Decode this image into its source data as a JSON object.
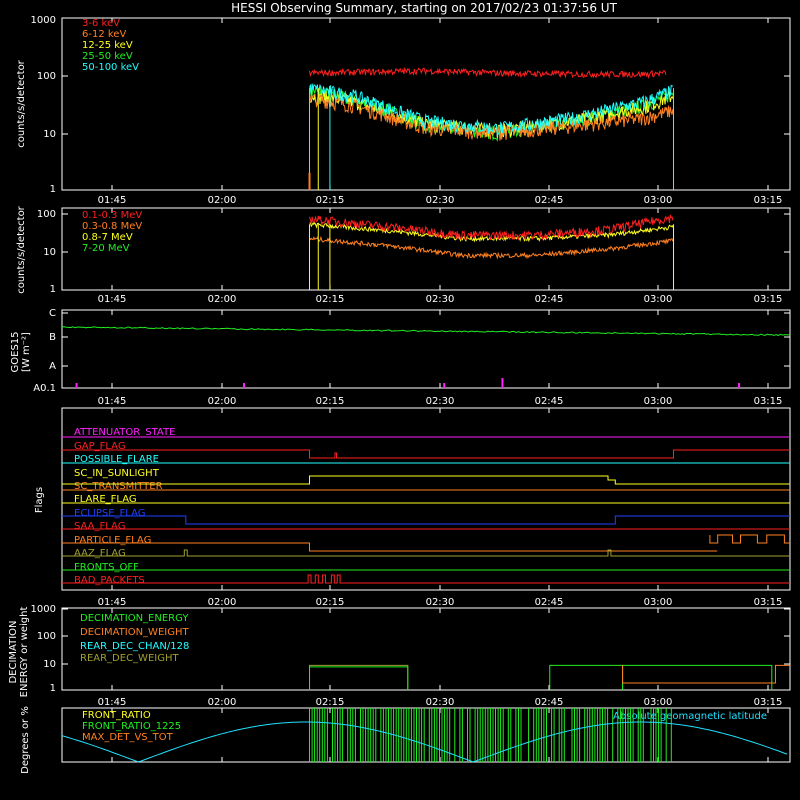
{
  "title": "HESSI Observing Summary, starting on 2017/02/23 01:37:56 UT",
  "colors": {
    "red": "#ff2020",
    "orange": "#ff8020",
    "yellow": "#ffff20",
    "green": "#20ee20",
    "cyan": "#20ffff",
    "magenta": "#ff20ff",
    "blue": "#2040ff",
    "olive": "#a0a030",
    "white": "#ffffff",
    "light_blue": "#20e0ff"
  },
  "time_ticks": [
    "01:45",
    "02:00",
    "02:15",
    "02:30",
    "02:45",
    "03:00",
    "03:15"
  ],
  "chart_data": [
    {
      "type": "line",
      "name": "xray-lightcurve",
      "ylabel": "counts/s/detector",
      "yscale": "log",
      "yticks": [
        "1",
        "10",
        "100",
        "1000"
      ],
      "legend": [
        {
          "label": "3-6 keV",
          "color": "#ff2020"
        },
        {
          "label": "6-12 keV",
          "color": "#ff8020"
        },
        {
          "label": "12-25 keV",
          "color": "#ffff20"
        },
        {
          "label": "25-50 keV",
          "color": "#20ee20"
        },
        {
          "label": "50-100 keV",
          "color": "#20ffff"
        }
      ],
      "legend_placement": "top-left",
      "x_unit": "minutes since 01:37:56",
      "x_range": [
        0,
        100
      ],
      "ylim": [
        1,
        1000
      ],
      "data_interval": [
        34,
        84
      ],
      "series": [
        {
          "name": "3-6 keV",
          "points": [
            [
              34,
              110
            ],
            [
              50,
              120
            ],
            [
              60,
              110
            ],
            [
              70,
              105
            ],
            [
              80,
              105
            ],
            [
              83,
              110
            ]
          ]
        },
        {
          "name": "6-12 keV",
          "points": [
            [
              34,
              40
            ],
            [
              40,
              30
            ],
            [
              50,
              12
            ],
            [
              60,
              10
            ],
            [
              70,
              13
            ],
            [
              80,
              18
            ],
            [
              84,
              25
            ]
          ]
        },
        {
          "name": "12-25 keV",
          "points": [
            [
              34,
              45
            ],
            [
              40,
              35
            ],
            [
              50,
              14
            ],
            [
              60,
              11
            ],
            [
              70,
              16
            ],
            [
              80,
              28
            ],
            [
              84,
              45
            ]
          ]
        },
        {
          "name": "25-50 keV",
          "points": [
            [
              34,
              55
            ],
            [
              40,
              40
            ],
            [
              50,
              14
            ],
            [
              60,
              10
            ],
            [
              70,
              15
            ],
            [
              80,
              30
            ],
            [
              84,
              50
            ]
          ]
        },
        {
          "name": "50-100 keV",
          "points": [
            [
              34,
              60
            ],
            [
              40,
              45
            ],
            [
              50,
              16
            ],
            [
              60,
              12
            ],
            [
              70,
              18
            ],
            [
              80,
              35
            ],
            [
              84,
              55
            ]
          ]
        }
      ]
    },
    {
      "type": "line",
      "name": "gamma-lightcurve",
      "ylabel": "counts/s/detector",
      "yscale": "log",
      "yticks": [
        "1",
        "10",
        "100"
      ],
      "legend": [
        {
          "label": "0.1-0.3 MeV",
          "color": "#ff2020"
        },
        {
          "label": "0.3-0.8 MeV",
          "color": "#ff8020"
        },
        {
          "label": "0.8-7 MeV",
          "color": "#ffff20"
        },
        {
          "label": "7-20 MeV",
          "color": "#20ee20"
        }
      ],
      "ylim": [
        1,
        100
      ]
    },
    {
      "type": "line",
      "name": "goes",
      "ylabel": "GOES15",
      "ylabel2": "[W m⁻²]",
      "yticks": [
        "A0.1",
        "A",
        "B",
        "C"
      ]
    },
    {
      "type": "table",
      "name": "flags",
      "ylabel": "Flags",
      "flags": [
        {
          "label": "ATTENUATOR_STATE",
          "color": "#ff20ff"
        },
        {
          "label": "GAP_FLAG",
          "color": "#ff2020"
        },
        {
          "label": "POSSIBLE_FLARE",
          "color": "#20ffff"
        },
        {
          "label": "SC_IN_SUNLIGHT",
          "color": "#ffff20"
        },
        {
          "label": "SC_TRANSMITTER",
          "color": "#ff8020"
        },
        {
          "label": "FLARE_FLAG",
          "color": "#ffff20"
        },
        {
          "label": "ECLIPSE_FLAG",
          "color": "#2040ff"
        },
        {
          "label": "SAA_FLAG",
          "color": "#ff2020"
        },
        {
          "label": "PARTICLE_FLAG",
          "color": "#ff8020"
        },
        {
          "label": "AAZ_FLAG",
          "color": "#a0a030"
        },
        {
          "label": "FRONTS_OFF",
          "color": "#20ee20"
        },
        {
          "label": "BAD_PACKETS",
          "color": "#ff2020"
        }
      ]
    },
    {
      "type": "line",
      "name": "decimation",
      "ylabel": "DECIMATION",
      "ylabel2": "ENERGY or weight",
      "yticks": [
        "1",
        "10",
        "100",
        "1000"
      ],
      "legend": [
        {
          "label": "DECIMATION_ENERGY",
          "color": "#20ee20"
        },
        {
          "label": "DECIMATION_WEIGHT",
          "color": "#ff8020"
        },
        {
          "label": "REAR_DEC_CHAN/128",
          "color": "#20ffff"
        },
        {
          "label": "REAR_DEC_WEIGHT",
          "color": "#a0a030"
        }
      ]
    },
    {
      "type": "line",
      "name": "geo",
      "ylabel": "Degrees or %",
      "legend": [
        {
          "label": "FRONT_RATIO",
          "color": "#ffff20"
        },
        {
          "label": "FRONT_RATIO_1225",
          "color": "#20ee20"
        },
        {
          "label": "MAX_DET_VS_TOT",
          "color": "#ff8020"
        }
      ],
      "annotation": "Absolute geomagnetic latitude"
    }
  ]
}
